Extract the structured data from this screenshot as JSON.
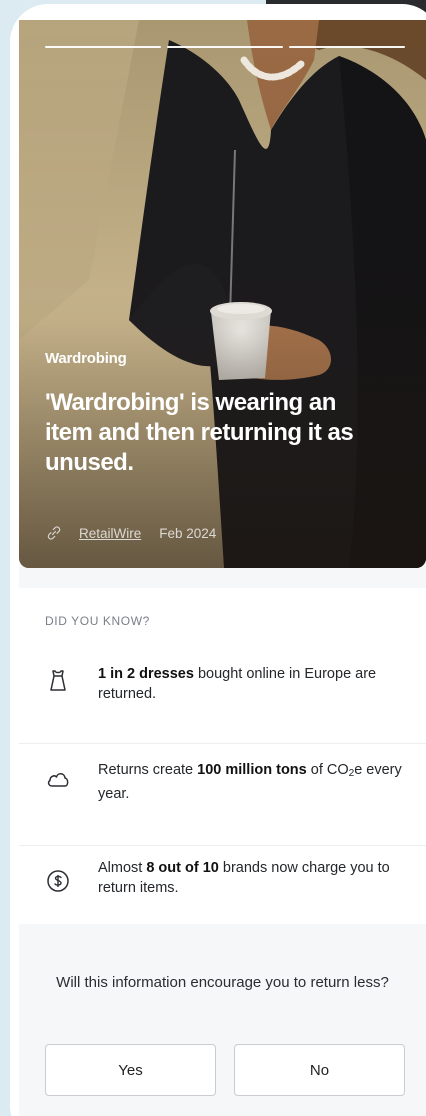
{
  "story": {
    "progress_segments": 3,
    "tag": "Wardrobing",
    "title": "'Wardrobing' is wearing an item and then returning it as unused.",
    "source_name": "RetailWire",
    "source_date": "Feb 2024"
  },
  "did_you_know": {
    "label": "DID YOU KNOW?",
    "facts": [
      {
        "icon": "dress-icon",
        "bold": "1 in 2 dresses",
        "rest": " bought online in Europe are returned."
      },
      {
        "icon": "cloud-icon",
        "pre": "Returns create ",
        "bold": "100 million tons",
        "mid": " of CO",
        "sub": "2",
        "rest": "e every year."
      },
      {
        "icon": "dollar-coin-icon",
        "pre": "Almost ",
        "bold": "8 out of 10",
        "rest": " brands now charge you to return items."
      }
    ]
  },
  "question": {
    "text": "Will this information encourage you to return less?",
    "yes_label": "Yes",
    "no_label": "No"
  },
  "colors": {
    "page_bg": "#dcebf1",
    "hero_warm": "#c2ad82",
    "jacket": "#1b1a1d"
  }
}
